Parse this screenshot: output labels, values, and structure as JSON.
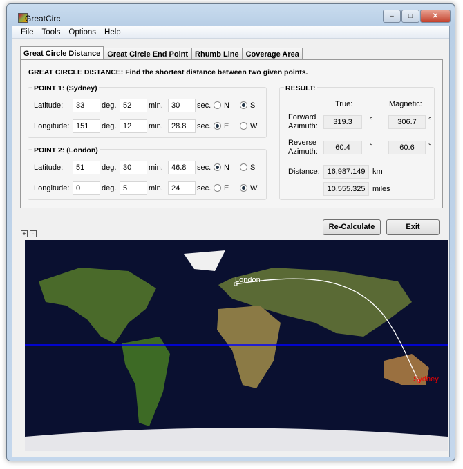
{
  "window": {
    "title": "GreatCirc"
  },
  "menu": [
    "File",
    "Tools",
    "Options",
    "Help"
  ],
  "tabs": [
    "Great Circle Distance",
    "Great Circle End Point",
    "Rhumb Line",
    "Coverage Area"
  ],
  "heading": "GREAT CIRCLE DISTANCE: Find the shortest distance between two given points.",
  "point1": {
    "title": "POINT 1: (Sydney)",
    "lat": {
      "label": "Latitude:",
      "deg": "33",
      "min": "52",
      "sec": "30",
      "opt1": "N",
      "opt2": "S",
      "selected": "S"
    },
    "lon": {
      "label": "Longitude:",
      "deg": "151",
      "min": "12",
      "sec": "28.8",
      "opt1": "E",
      "opt2": "W",
      "selected": "E"
    }
  },
  "point2": {
    "title": "POINT 2: (London)",
    "lat": {
      "label": "Latitude:",
      "deg": "51",
      "min": "30",
      "sec": "46.8",
      "opt1": "N",
      "opt2": "S",
      "selected": "N"
    },
    "lon": {
      "label": "Longitude:",
      "deg": "0",
      "min": "5",
      "sec": "24",
      "opt1": "E",
      "opt2": "W",
      "selected": "W"
    }
  },
  "units": {
    "deg": "deg.",
    "min": "min.",
    "sec": "sec."
  },
  "result": {
    "title": "RESULT:",
    "true_label": "True:",
    "magnetic_label": "Magnetic:",
    "fwd_label1": "Forward",
    "fwd_label2": "Azimuth:",
    "rev_label1": "Reverse",
    "rev_label2": "Azimuth:",
    "fwd_true": "319.3",
    "fwd_mag": "306.7",
    "rev_true": "60.4",
    "rev_mag": "60.6",
    "degree": "°",
    "distance_label": "Distance:",
    "km": "16,987.149",
    "km_unit": "km",
    "miles": "10,555.325",
    "miles_unit": "miles"
  },
  "buttons": {
    "recalc": "Re-Calculate",
    "exit": "Exit",
    "zoom_in": "+",
    "zoom_out": "-"
  },
  "map": {
    "label_london": "London",
    "label_sydney": "Sydney",
    "equator_color": "#0000ff",
    "path_color": "#ffffff"
  }
}
